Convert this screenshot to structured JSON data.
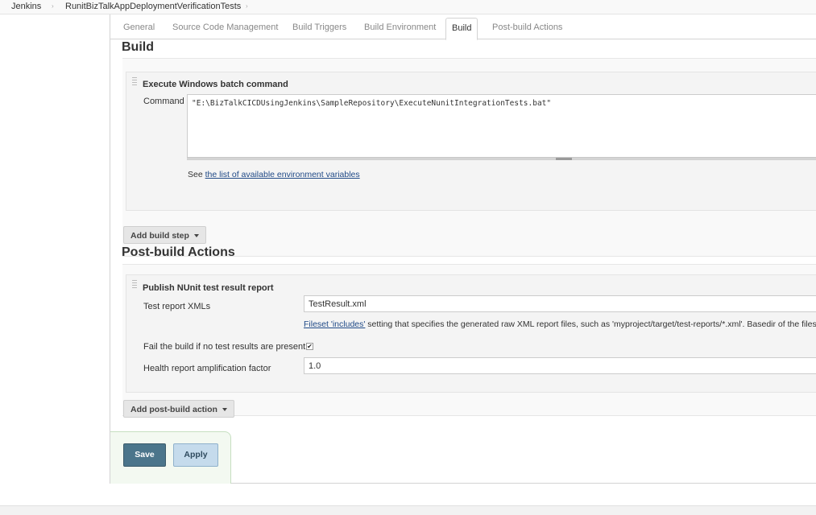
{
  "breadcrumb": {
    "items": [
      "Jenkins",
      "RunitBizTalkAppDeploymentVerificationTests"
    ],
    "separator": "›"
  },
  "tabs": [
    {
      "label": "General"
    },
    {
      "label": "Source Code Management"
    },
    {
      "label": "Build Triggers"
    },
    {
      "label": "Build Environment"
    },
    {
      "label": "Build",
      "active": true
    },
    {
      "label": "Post-build Actions"
    }
  ],
  "build": {
    "heading": "Build",
    "step_title": "Execute Windows batch command",
    "command_label": "Command",
    "command_value": "\"E:\\BizTalkCICDUsingJenkins\\SampleRepository\\ExecuteNunitIntegrationTests.bat\"",
    "help_prefix": "See",
    "help_link": "the list of available environment variables",
    "add_step_label": "Add build step"
  },
  "post_build": {
    "heading": "Post-build Actions",
    "action_title": "Publish NUnit test result report",
    "xml_label": "Test report XMLs",
    "xml_value": "TestResult.xml",
    "xml_help_link": "Fileset 'includes'",
    "xml_help_text": " setting that specifies the generated raw XML report files, such as 'myproject/target/test-reports/*.xml'. Basedir of the files",
    "fail_label": "Fail the build if no test results are present",
    "fail_checked": true,
    "fail_check_glyph": "✔",
    "health_label": "Health report amplification factor",
    "health_value": "1.0",
    "add_action_label": "Add post-build action"
  },
  "buttons": {
    "save": "Save",
    "apply": "Apply"
  },
  "colors": {
    "save_bg": "#4b758b",
    "apply_bg": "#c5dbec",
    "link": "#204a87"
  }
}
